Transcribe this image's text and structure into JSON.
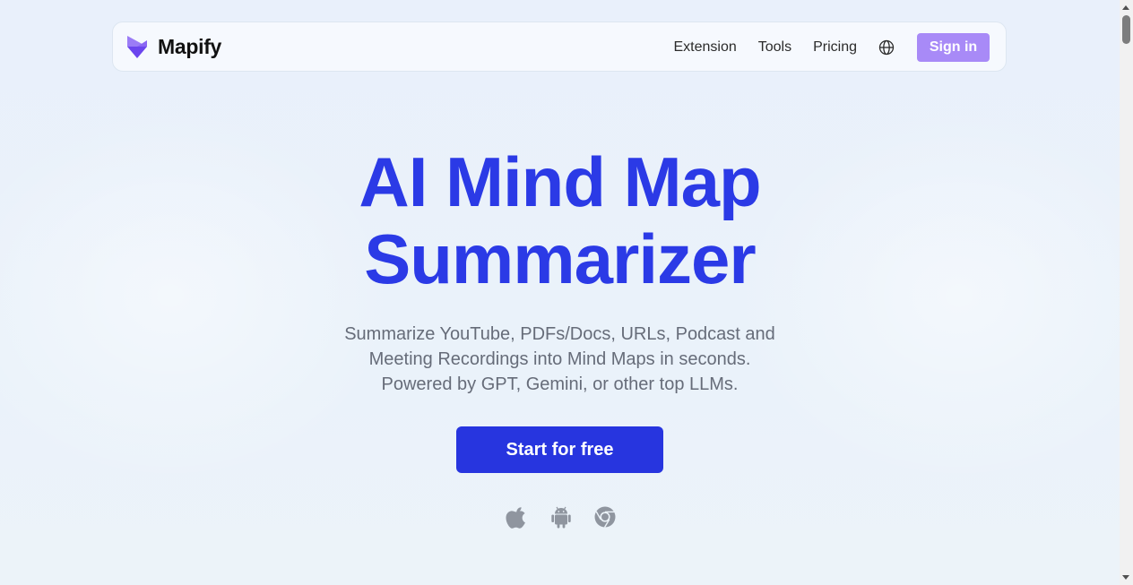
{
  "brand": {
    "name": "Mapify",
    "logo_icon": "lightning-bolt-icon",
    "colors": {
      "primary": "#2735df",
      "title": "#2b3ae6",
      "signin": "#a88af7",
      "logo_purple": "#7b52f0"
    }
  },
  "nav": {
    "links": [
      {
        "label": "Extension"
      },
      {
        "label": "Tools"
      },
      {
        "label": "Pricing"
      }
    ],
    "language_icon": "globe-icon",
    "sign_in_label": "Sign in"
  },
  "hero": {
    "title_line1": "AI Mind Map",
    "title_line2": "Summarizer",
    "subtitle_lines": [
      "Summarize YouTube, PDFs/Docs, URLs, Podcast and",
      "Meeting Recordings into Mind Maps in seconds.",
      "Powered by GPT, Gemini, or other top LLMs."
    ],
    "cta_label": "Start for free",
    "platform_icons": [
      "apple-icon",
      "android-icon",
      "chrome-icon"
    ]
  }
}
